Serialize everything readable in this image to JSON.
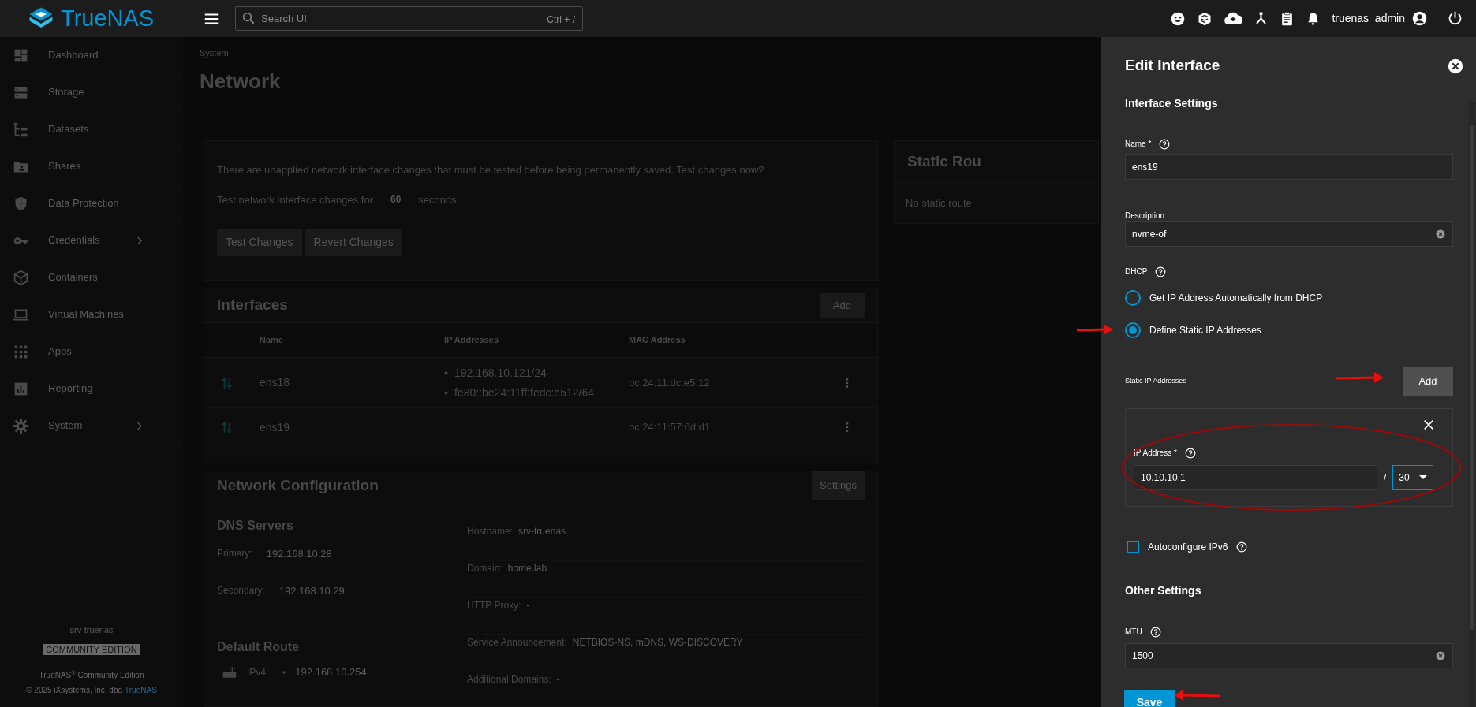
{
  "header": {
    "logo_text": "TrueNAS",
    "search_placeholder": "Search UI",
    "search_shortcut": "Ctrl + /",
    "username": "truenas_admin"
  },
  "sidebar": {
    "items": [
      {
        "label": "Dashboard",
        "has_submenu": false
      },
      {
        "label": "Storage",
        "has_submenu": false
      },
      {
        "label": "Datasets",
        "has_submenu": false
      },
      {
        "label": "Shares",
        "has_submenu": false
      },
      {
        "label": "Data Protection",
        "has_submenu": false
      },
      {
        "label": "Credentials",
        "has_submenu": true
      },
      {
        "label": "Containers",
        "has_submenu": false
      },
      {
        "label": "Virtual Machines",
        "has_submenu": false
      },
      {
        "label": "Apps",
        "has_submenu": false
      },
      {
        "label": "Reporting",
        "has_submenu": false
      },
      {
        "label": "System",
        "has_submenu": true
      }
    ],
    "hostname": "srv-truenas",
    "edition_badge": "COMMUNITY EDITION",
    "product": "TrueNAS$^{®}$ Community Edition",
    "copyright": "© 2025 iXsystems, Inc. dba",
    "copyright_link": "TrueNAS"
  },
  "page": {
    "breadcrumb": "System",
    "title": "Network"
  },
  "pending_changes": {
    "message": "There are unapplied network interface changes that must be tested before being permanently saved. Test changes now?",
    "timeout_prefix": "Test network interface changes for",
    "timeout_value": "60",
    "timeout_suffix": "seconds.",
    "buttons": [
      "Test Changes",
      "Revert Changes"
    ]
  },
  "interfaces": {
    "title": "Interfaces",
    "add_button": "Add",
    "columns": [
      "Name",
      "IP Addresses",
      "MAC Address"
    ],
    "rows": [
      {
        "name": "ens18",
        "ip_addresses": [
          "192.168.10.121/24",
          "fe80::be24:11ff:fedc:e512/64"
        ],
        "mac": "bc:24:11:dc:e5:12"
      },
      {
        "name": "ens19",
        "ip_addresses": [],
        "mac": "bc:24:11:57:6d:d1"
      }
    ]
  },
  "network_configuration": {
    "title": "Network Configuration",
    "settings_button": "Settings",
    "dns_title": "DNS Servers",
    "dns": [
      {
        "label": "Primary:",
        "value": "192.168.10.28"
      },
      {
        "label": "Secondary:",
        "value": "192.168.10.29"
      }
    ],
    "default_route_title": "Default Route",
    "default_route": [
      {
        "label": "IPv4:",
        "value": "192.168.10.254"
      }
    ],
    "details": [
      {
        "label": "Hostname:",
        "value": "srv-truenas"
      },
      {
        "label": "Domain:",
        "value": "home.lab"
      },
      {
        "label": "HTTP Proxy:",
        "value": "-"
      },
      {
        "label": "Service Announcement:",
        "value": "NETBIOS-NS, mDNS, WS-DISCOVERY"
      },
      {
        "label": "Additional Domains:",
        "value": "-"
      }
    ]
  },
  "static_routes": {
    "title": "Static Rou",
    "message": "No static route"
  },
  "edit_panel": {
    "title": "Edit Interface",
    "section": "Interface Settings",
    "name": {
      "label": "Name *",
      "value": "ens19"
    },
    "description": {
      "label": "Description",
      "value": "nvme-of"
    },
    "dhcp": {
      "label": "DHCP",
      "options": [
        {
          "label": "Get IP Address Automatically from DHCP",
          "selected": false
        },
        {
          "label": "Define Static IP Addresses",
          "selected": true
        }
      ]
    },
    "static_ip": {
      "label": "Static IP Addresses",
      "add_button": "Add",
      "entries": [
        {
          "label": "IP Address *",
          "address": "10.10.10.1",
          "separator": "/",
          "netmask": "30"
        }
      ]
    },
    "autoconfigure_ipv6": {
      "label": "Autoconfigure IPv6",
      "checked": false
    },
    "other_section": "Other Settings",
    "mtu": {
      "label": "MTU",
      "value": "1500"
    },
    "save_button": "Save"
  }
}
